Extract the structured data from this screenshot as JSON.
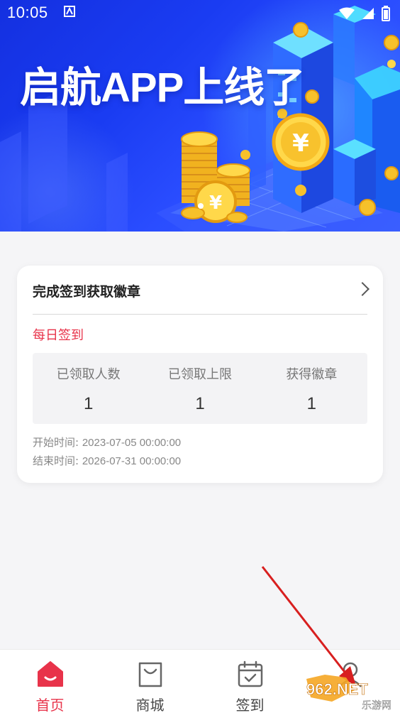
{
  "status_bar": {
    "time": "10:05"
  },
  "banner": {
    "title": "启航APP上线了"
  },
  "card": {
    "header_title": "完成签到获取徽章",
    "section_title": "每日签到",
    "stats": [
      {
        "label": "已领取人数",
        "value": "1"
      },
      {
        "label": "已领取上限",
        "value": "1"
      },
      {
        "label": "获得徽章",
        "value": "1"
      }
    ],
    "start_label": "开始时间:",
    "start_value": "2023-07-05 00:00:00",
    "end_label": "结束时间:",
    "end_value": "2026-07-31 00:00:00"
  },
  "bottom_nav": [
    {
      "label": "首页",
      "icon": "home-icon",
      "active": true
    },
    {
      "label": "商城",
      "icon": "shopping-bag-icon",
      "active": false
    },
    {
      "label": "签到",
      "icon": "calendar-check-icon",
      "active": false
    },
    {
      "label": "",
      "icon": "user-icon",
      "active": false
    }
  ],
  "watermark": {
    "text": "962.NET",
    "subtext": "乐游网"
  },
  "colors": {
    "accent": "#e8334a",
    "banner_blue": "#1a3cf2",
    "gold": "#f6c12b"
  }
}
